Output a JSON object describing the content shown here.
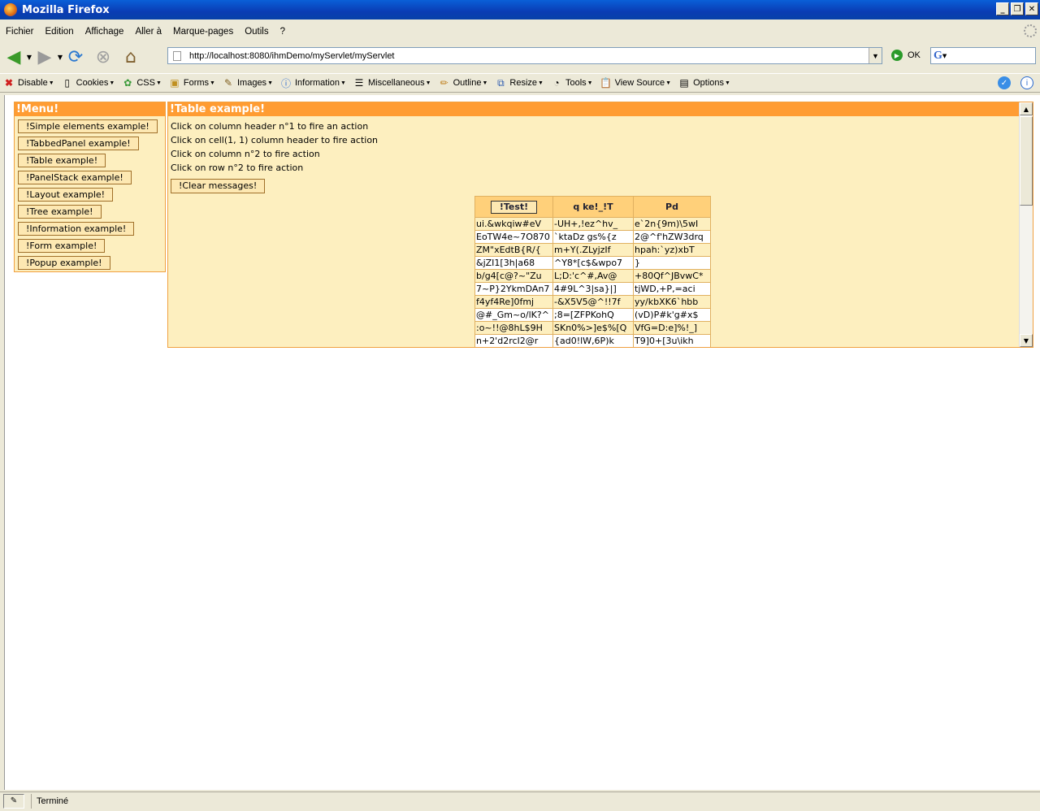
{
  "window": {
    "title": "Mozilla Firefox"
  },
  "menu": [
    "Fichier",
    "Edition",
    "Affichage",
    "Aller à",
    "Marque-pages",
    "Outils",
    "?"
  ],
  "nav": {
    "url": "http://localhost:8080/ihmDemo/myServlet/myServlet",
    "ok_label": "OK",
    "search_engine": "G"
  },
  "devtools": [
    {
      "label": "Disable",
      "icon": "disable-icon"
    },
    {
      "label": "Cookies",
      "icon": "cookies-icon"
    },
    {
      "label": "CSS",
      "icon": "css-icon"
    },
    {
      "label": "Forms",
      "icon": "forms-icon"
    },
    {
      "label": "Images",
      "icon": "images-icon"
    },
    {
      "label": "Information",
      "icon": "information-icon"
    },
    {
      "label": "Miscellaneous",
      "icon": "miscellaneous-icon"
    },
    {
      "label": "Outline",
      "icon": "outline-icon"
    },
    {
      "label": "Resize",
      "icon": "resize-icon"
    },
    {
      "label": "Tools",
      "icon": "tools-icon"
    },
    {
      "label": "View Source",
      "icon": "view-source-icon"
    },
    {
      "label": "Options",
      "icon": "options-icon"
    }
  ],
  "menupanel": {
    "title": "!Menu!",
    "buttons": [
      "!Simple elements example!",
      "!TabbedPanel example!",
      "!Table example!",
      "!PanelStack example!",
      "!Layout example!",
      "!Tree example!",
      "!Information example!",
      "!Form example!",
      "!Popup example!"
    ]
  },
  "tablepanel": {
    "title": "!Table example!",
    "messages": [
      "Click on column header n°1 to fire an action",
      "Click on cell(1, 1) column header to fire action",
      "Click on column n°2 to fire action",
      "Click on row n°2 to fire action"
    ],
    "clear_label": "!Clear messages!",
    "headers": [
      "!Test!",
      "q ke!_!T",
      "Pd"
    ],
    "rows": [
      [
        "ui.&wkqiw#eV",
        "-UH+,!ez^hv_",
        "e`2n{9m)\\5wI"
      ],
      [
        "EoTW4e~7O870",
        "`ktaDz gs%{z",
        "2@^f'hZW3drq"
      ],
      [
        "ZM\"xEdtB{R/{",
        "m+Y(.ZLyjzIf",
        "hpah:`yz)xbT"
      ],
      [
        "&jZI1[3h|a68",
        "^Y8*[c$&wpo7",
        "}"
      ],
      [
        "b/g4[c@?~\"Zu",
        "L;D:'c^#,Av@",
        "+80Qf^JBvwC*"
      ],
      [
        "7~P}2YkmDAn7",
        "4#9L^3|sa}|]",
        "tjWD,+P,=aci"
      ],
      [
        "f4yf4Re]0fmj",
        "-&X5V5@^!!7f",
        "yy/kbXK6`hbb"
      ],
      [
        "@#_Gm~o/lK?^",
        ";8=[ZFPKohQ",
        "(vD)P#k'g#x$"
      ],
      [
        ":o~!!@8hL$9H",
        "SKn0%>]e$%[Q",
        "VfG=D:e]%!_]"
      ],
      [
        "n+2'd2rcI2@r",
        "{ad0!lW,6P)k",
        "T9]0+[3u\\ikh"
      ]
    ]
  },
  "status": {
    "text": "Terminé"
  }
}
